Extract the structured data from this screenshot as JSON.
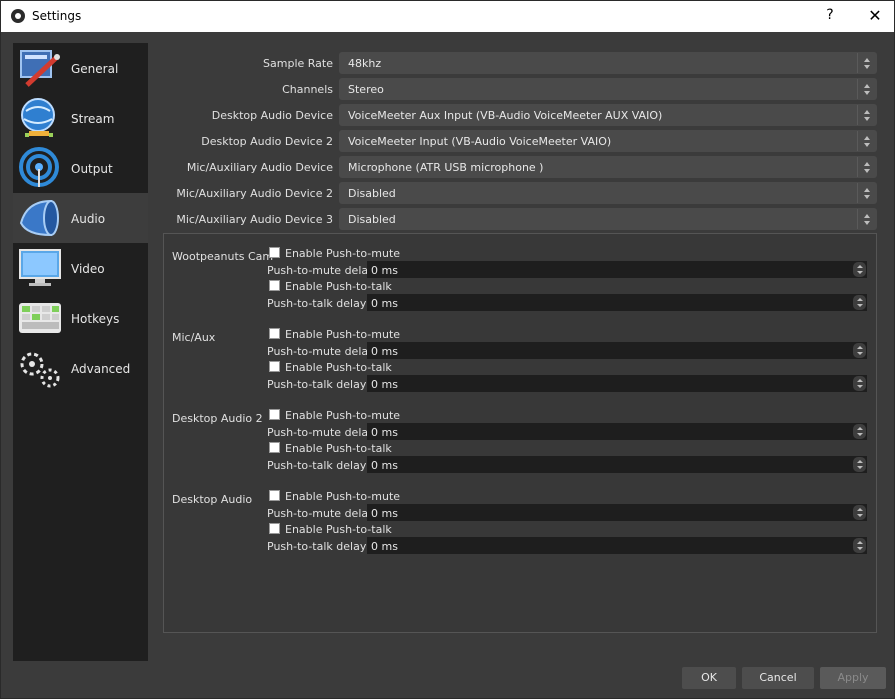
{
  "window": {
    "title": "Settings",
    "help": "?",
    "close": "✕"
  },
  "sidebar": {
    "items": [
      {
        "label": "General",
        "icon": "general-icon",
        "active": false
      },
      {
        "label": "Stream",
        "icon": "stream-icon",
        "active": false
      },
      {
        "label": "Output",
        "icon": "output-icon",
        "active": false
      },
      {
        "label": "Audio",
        "icon": "audio-icon",
        "active": true
      },
      {
        "label": "Video",
        "icon": "video-icon",
        "active": false
      },
      {
        "label": "Hotkeys",
        "icon": "hotkeys-icon",
        "active": false
      },
      {
        "label": "Advanced",
        "icon": "advanced-icon",
        "active": false
      }
    ]
  },
  "audio": {
    "fields": [
      {
        "label": "Sample Rate",
        "value": "48khz"
      },
      {
        "label": "Channels",
        "value": "Stereo"
      },
      {
        "label": "Desktop Audio Device",
        "value": "VoiceMeeter Aux Input (VB-Audio VoiceMeeter AUX VAIO)"
      },
      {
        "label": "Desktop Audio Device 2",
        "value": "VoiceMeeter Input (VB-Audio VoiceMeeter VAIO)"
      },
      {
        "label": "Mic/Auxiliary Audio Device",
        "value": "Microphone (ATR USB microphone )"
      },
      {
        "label": "Mic/Auxiliary Audio Device 2",
        "value": "Disabled"
      },
      {
        "label": "Mic/Auxiliary Audio Device 3",
        "value": "Disabled"
      }
    ],
    "hotkey_groups": [
      {
        "name": "Wootpeanuts Cam",
        "mute_label": "Enable Push-to-mute",
        "mute_delay_label": "Push-to-mute delay",
        "mute_delay": "0 ms",
        "talk_label": "Enable Push-to-talk",
        "talk_delay_label": "Push-to-talk delay",
        "talk_delay": "0 ms"
      },
      {
        "name": "Mic/Aux",
        "mute_label": "Enable Push-to-mute",
        "mute_delay_label": "Push-to-mute delay",
        "mute_delay": "0 ms",
        "talk_label": "Enable Push-to-talk",
        "talk_delay_label": "Push-to-talk delay",
        "talk_delay": "0 ms"
      },
      {
        "name": "Desktop Audio 2",
        "mute_label": "Enable Push-to-mute",
        "mute_delay_label": "Push-to-mute delay",
        "mute_delay": "0 ms",
        "talk_label": "Enable Push-to-talk",
        "talk_delay_label": "Push-to-talk delay",
        "talk_delay": "0 ms"
      },
      {
        "name": "Desktop Audio",
        "mute_label": "Enable Push-to-mute",
        "mute_delay_label": "Push-to-mute delay",
        "mute_delay": "0 ms",
        "talk_label": "Enable Push-to-talk",
        "talk_delay_label": "Push-to-talk delay",
        "talk_delay": "0 ms"
      }
    ]
  },
  "buttons": {
    "ok": "OK",
    "cancel": "Cancel",
    "apply": "Apply"
  }
}
